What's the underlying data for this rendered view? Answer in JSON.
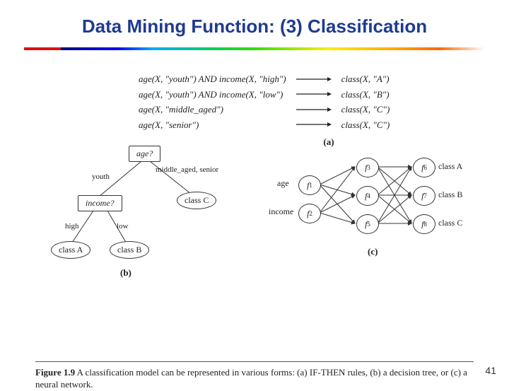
{
  "title": "Data Mining Function: (3) Classification",
  "page_number": "41",
  "rules": [
    {
      "lhs": "age(X, \"youth\") AND income(X, \"high\")",
      "rhs": "class(X, \"A\")"
    },
    {
      "lhs": "age(X, \"youth\") AND income(X, \"low\")",
      "rhs": "class(X, \"B\")"
    },
    {
      "lhs": "age(X, \"middle_aged\")",
      "rhs": "class(X, \"C\")"
    },
    {
      "lhs": "age(X, \"senior\")",
      "rhs": "class(X, \"C\")"
    }
  ],
  "part_labels": {
    "a": "(a)",
    "b": "(b)",
    "c": "(c)"
  },
  "tree": {
    "root": "age?",
    "root_branches": {
      "left": "youth",
      "right": "middle_aged, senior"
    },
    "income_node": "income?",
    "income_branches": {
      "left": "high",
      "right": "low"
    },
    "leaves": {
      "classA": "class A",
      "classB": "class B",
      "classC": "class C"
    }
  },
  "nn": {
    "input_labels": {
      "age": "age",
      "income": "income"
    },
    "f": [
      "f",
      "f",
      "f",
      "f",
      "f",
      "f",
      "f",
      "f"
    ],
    "f_sub": [
      "1",
      "2",
      "3",
      "4",
      "5",
      "6",
      "7",
      "8"
    ],
    "out_labels": {
      "a": "class A",
      "b": "class B",
      "c": "class C"
    }
  },
  "caption": {
    "fig": "Figure 1.9",
    "text": "A classification model can be represented in various forms: (a) IF-THEN rules, (b) a decision tree, or (c) a neural network."
  }
}
